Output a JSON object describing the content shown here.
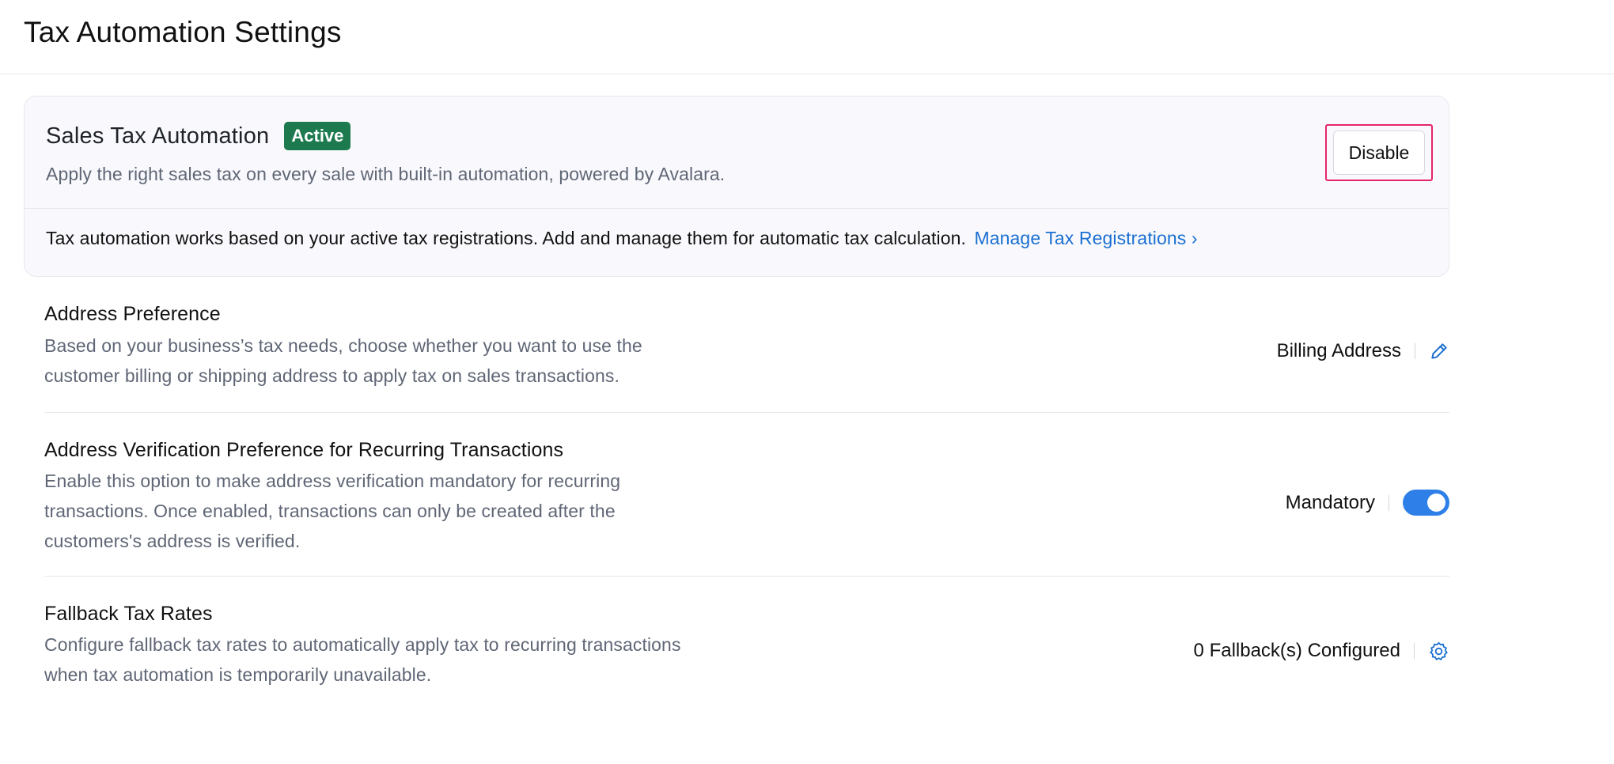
{
  "page": {
    "title": "Tax Automation Settings"
  },
  "automation": {
    "title": "Sales Tax Automation",
    "status": "Active",
    "description": "Apply the right sales tax on every sale with built-in automation, powered by Avalara.",
    "disable_label": "Disable",
    "info_text": "Tax automation works based on your active tax registrations. Add and manage them for automatic tax calculation.",
    "manage_link_label": "Manage Tax Registrations ›"
  },
  "settings": {
    "address_preference": {
      "title": "Address Preference",
      "description_line1": "Based on your business’s tax needs, choose whether you want to use the",
      "description_line2": "customer billing or shipping address to apply tax on sales transactions.",
      "value": "Billing Address",
      "action_icon": "pencil-icon"
    },
    "address_verification": {
      "title": "Address Verification Preference for Recurring Transactions",
      "description_line1": "Enable this option to make address verification mandatory for recurring",
      "description_line2": "transactions. Once enabled, transactions can only be created after the",
      "description_line3": "customers's address is verified.",
      "value": "Mandatory",
      "toggle_on": true
    },
    "fallback_tax_rates": {
      "title": "Fallback Tax Rates",
      "description_line1": "Configure fallback tax rates to automatically apply tax to recurring transactions",
      "description_line2": "when tax automation is temporarily unavailable.",
      "value": "0 Fallback(s) Configured",
      "action_icon": "gear-icon"
    }
  },
  "colors": {
    "status_active": "#1d7a4f",
    "link": "#1a6fd1",
    "toggle_on": "#2f7fe8",
    "focus_outline": "#e5246a"
  }
}
